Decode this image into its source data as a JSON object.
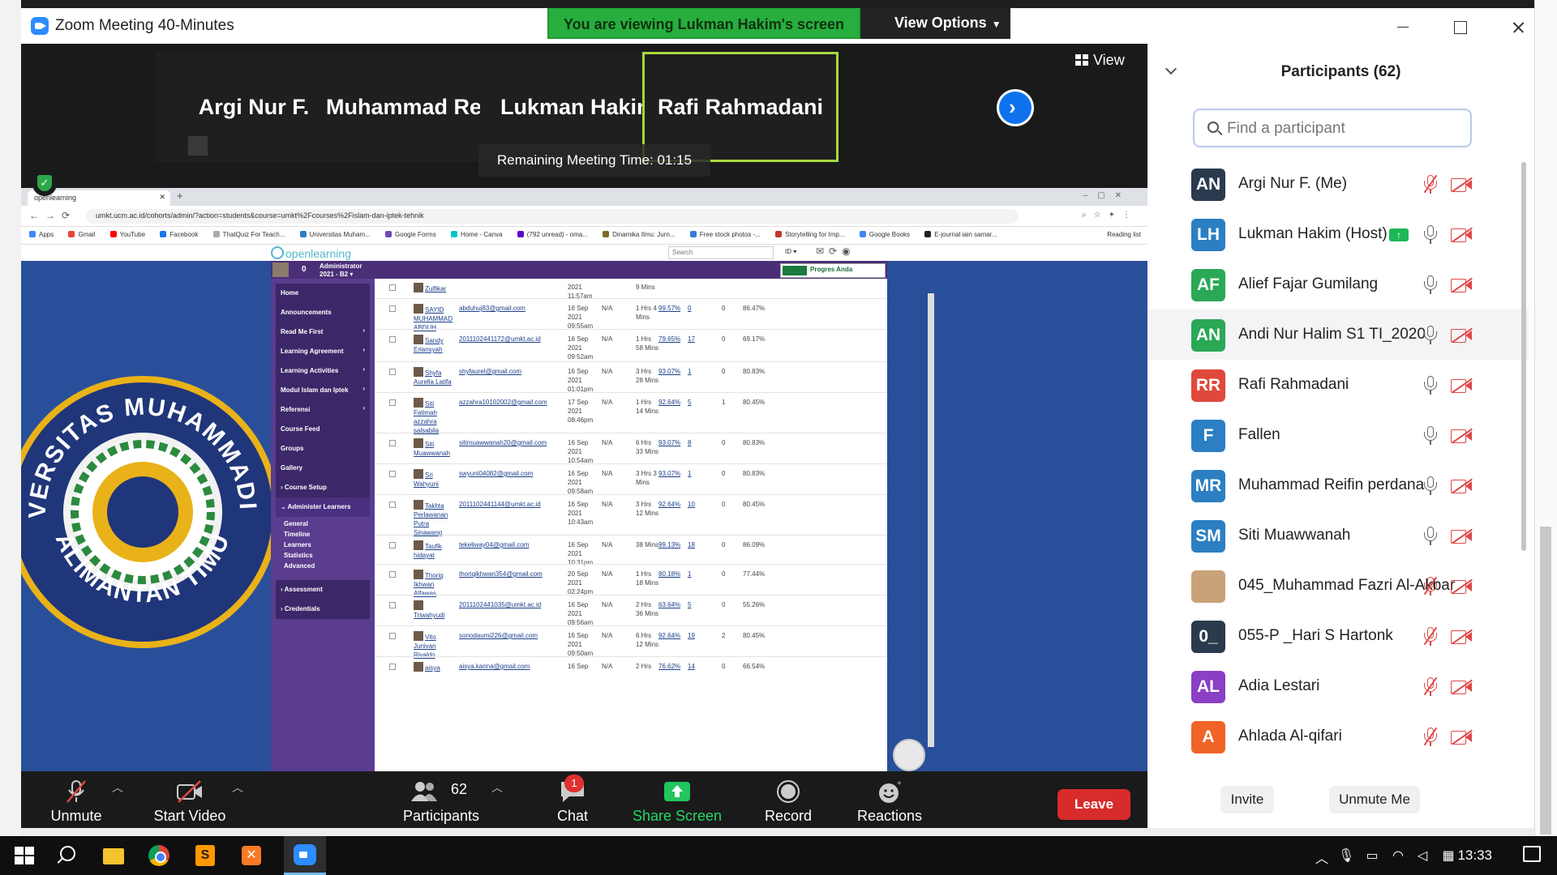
{
  "window": {
    "title": "Zoom Meeting 40-Minutes"
  },
  "banner": {
    "viewing": "You are viewing Lukman Hakim's screen",
    "view_options": "View Options"
  },
  "gallery": {
    "tiles": [
      "Argi Nur F.",
      "Muhammad  Rei...",
      "Lukman Hakim",
      "Rafi Rahmadani"
    ],
    "view_label": "View"
  },
  "remaining_time": "Remaining Meeting Time: 01:15",
  "browser": {
    "tab_title": "openlearning",
    "url": "umkt.ucm.ac.id/cohorts/admin/?action=students&course=umkt%2Fcourses%2Fislam-dan-iptek-tehnik",
    "bookmarks": [
      "Apps",
      "Gmail",
      "YouTube",
      "Facebook",
      "ThatQuiz For Teach...",
      "Universitas Muham...",
      "Google Forms",
      "Home - Canva",
      "(792 unread) - oma...",
      "Dinamika Ilmu: Jurn...",
      "Free stock photos -...",
      "Storytelling for Imp...",
      "Google Books",
      "E-journal iain samar..."
    ],
    "reading_list": "Reading list"
  },
  "openlearning": {
    "logo": "openlearning",
    "search_placeholder": "Search",
    "lang": "ID ▾",
    "points": "0",
    "admin_name": "Administrator",
    "admin_term": "2021 - B2 ▾",
    "progress": "Progres Anda",
    "menu": [
      "Home",
      "Announcements",
      "Read Me First",
      "Learning Agreement",
      "Learning Activities",
      "Modul Islam dan Iptek",
      "Referensi",
      "Course Feed",
      "Groups",
      "Gallery",
      "Course Setup",
      "Administer Learners"
    ],
    "admin_sub": [
      "General",
      "Timeline",
      "Learners",
      "Statistics",
      "Advanced"
    ],
    "menu_bottom": [
      "Assessment",
      "Credentials"
    ],
    "rows": [
      {
        "name": "Zulfikar",
        "email": "",
        "date": "2021 11:57am",
        "na": "",
        "time": "9 Mins",
        "pct": "",
        "cnt": "",
        "zero": "",
        "score": ""
      },
      {
        "name": "SAYID MUHAMMAD ABDUH",
        "email": "abduhuj83@gmail.com",
        "date": "16 Sep 2021 09:55am",
        "na": "N/A",
        "time": "1 Hrs 4 Mins",
        "pct": "99.57%",
        "cnt": "0",
        "zero": "0",
        "score": "86.47%"
      },
      {
        "name": "Sandy Erlansyah",
        "email": "2011102441172@umkt.ac.id",
        "date": "16 Sep 2021 09:52am",
        "na": "N/A",
        "time": "1 Hrs 58 Mins",
        "pct": "79.65%",
        "cnt": "17",
        "zero": "0",
        "score": "69.17%"
      },
      {
        "name": "Shyfa Aurella Latifa",
        "email": "shyfaurel@gmail.com",
        "date": "16 Sep 2021 01:01pm",
        "na": "N/A",
        "time": "3 Hrs 28 Mins",
        "pct": "93.07%",
        "cnt": "1",
        "zero": "0",
        "score": "80.83%"
      },
      {
        "name": "Siti Fatimah azzahra salsabila",
        "email": "azzahra10102002@gmail.com",
        "date": "17 Sep 2021 08:46pm",
        "na": "N/A",
        "time": "1 Hrs 14 Mins",
        "pct": "92.64%",
        "cnt": "5",
        "zero": "1",
        "score": "80.45%"
      },
      {
        "name": "Siti Muawwanah",
        "email": "sitimuawwanah20@gmail.com",
        "date": "16 Sep 2021 10:54am",
        "na": "N/A",
        "time": "6 Hrs 33 Mins",
        "pct": "93.07%",
        "cnt": "8",
        "zero": "0",
        "score": "80.83%"
      },
      {
        "name": "Sri Wahyuni",
        "email": "swyuni04082@gmail.com",
        "date": "16 Sep 2021 09:58am",
        "na": "N/A",
        "time": "3 Hrs 3 Mins",
        "pct": "93.07%",
        "cnt": "1",
        "zero": "0",
        "score": "80.83%"
      },
      {
        "name": "Takhta Perlawanan Putra Sinawang",
        "email": "2011102441144@umkt.ac.id",
        "date": "16 Sep 2021 10:43am",
        "na": "N/A",
        "time": "3 Hrs 12 Mins",
        "pct": "92.64%",
        "cnt": "10",
        "zero": "0",
        "score": "80.45%"
      },
      {
        "name": "Taufik hidayat",
        "email": "tekeliway04@gmail.com",
        "date": "16 Sep 2021 10:31pm",
        "na": "N/A",
        "time": "38 Mins",
        "pct": "99.13%",
        "cnt": "18",
        "zero": "0",
        "score": "86.09%"
      },
      {
        "name": "Thoriq Ikhwan Alfawas",
        "email": "thoriqikhwan354@gmail.com",
        "date": "20 Sep 2021 02:24pm",
        "na": "N/A",
        "time": "1 Hrs 18 Mins",
        "pct": "80.18%",
        "cnt": "1",
        "zero": "0",
        "score": "77.44%"
      },
      {
        "name": "Triwahyudi",
        "email": "2011102441035@umkt.ac.id",
        "date": "16 Sep 2021 09:56am",
        "na": "N/A",
        "time": "2 Hrs 36 Mins",
        "pct": "63.64%",
        "cnt": "5",
        "zero": "0",
        "score": "55.26%"
      },
      {
        "name": "Vito Junivan Rivaldo",
        "email": "sonodaumi226@gmail.com",
        "date": "16 Sep 2021 09:50am",
        "na": "N/A",
        "time": "6 Hrs 12 Mins",
        "pct": "92.64%",
        "cnt": "19",
        "zero": "2",
        "score": "80.45%"
      },
      {
        "name": "aisya",
        "email": "aisya.karina@gmail.com",
        "date": "16 Sep",
        "na": "N/A",
        "time": "2 Hrs",
        "pct": "76.62%",
        "cnt": "14",
        "zero": "0",
        "score": "66.54%"
      }
    ]
  },
  "university_logo": {
    "top_text": "UNIVERSITAS MUHAMMADIYAH",
    "bottom_text": "KALIMANTAN TIMUR"
  },
  "toolbar": {
    "unmute": "Unmute",
    "start_video": "Start Video",
    "participants": "Participants",
    "participants_count": "62",
    "chat": "Chat",
    "chat_badge": "1",
    "share_screen": "Share Screen",
    "record": "Record",
    "reactions": "Reactions",
    "leave": "Leave"
  },
  "panel": {
    "title": "Participants (62)",
    "search_placeholder": "Find a participant",
    "participants": [
      {
        "initials": "AN",
        "name": "Argi Nur F. (Me)",
        "color": "#2b3a4e",
        "mic_muted": true
      },
      {
        "initials": "LH",
        "name": "Lukman Hakim (Host)",
        "color": "#2b7fc2",
        "mic_muted": false,
        "sharing": true
      },
      {
        "initials": "AF",
        "name": "Alief Fajar Gumilang",
        "color": "#2aa856",
        "mic_muted": false
      },
      {
        "initials": "AN",
        "name": "Andi Nur Halim S1 TI_2020",
        "color": "#2aa856",
        "mic_muted": false
      },
      {
        "initials": "RR",
        "name": "Rafi Rahmadani",
        "color": "#e0483c",
        "mic_muted": false
      },
      {
        "initials": "F",
        "name": "Fallen",
        "color": "#2b7fc2",
        "mic_muted": false
      },
      {
        "initials": "MR",
        "name": "Muhammad Reifin perdana",
        "color": "#2b7fc2",
        "mic_muted": false
      },
      {
        "initials": "SM",
        "name": "Siti Muawwanah",
        "color": "#2b7fc2",
        "mic_muted": false
      },
      {
        "initials": "",
        "name": "045_Muhammad Fazri Al-Akbar",
        "color": "#c9a27a",
        "mic_muted": true
      },
      {
        "initials": "0_",
        "name": "055-P _Hari S Hartonk",
        "color": "#2b3a4e",
        "mic_muted": true
      },
      {
        "initials": "AL",
        "name": "Adia Lestari",
        "color": "#8a3fc4",
        "mic_muted": true
      },
      {
        "initials": "A",
        "name": "Ahlada Al-qifari",
        "color": "#f06428",
        "mic_muted": true
      }
    ],
    "invite": "Invite",
    "unmute_me": "Unmute Me"
  },
  "taskbar": {
    "time": "13:33"
  }
}
